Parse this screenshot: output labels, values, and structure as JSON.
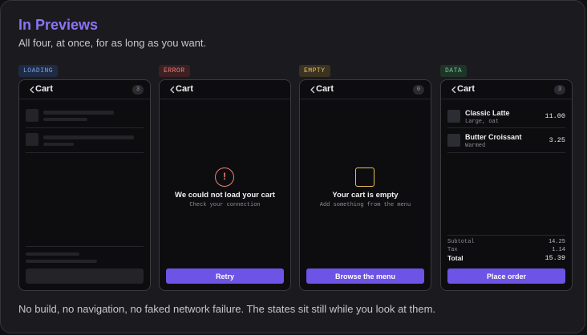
{
  "header": {
    "title": "In Previews",
    "subtitle": "All four, at once, for as long as you want."
  },
  "caption": "No build, no navigation, no faked network failure. The states sit still while you look at them.",
  "colors": {
    "accent": "#8c73f4",
    "button": "#6d53e6",
    "error": "#ec8076",
    "empty": "#e6c05c"
  },
  "previews": {
    "loading": {
      "badge": "LOADING",
      "title": "Cart",
      "count": "3",
      "icon": "chevron-left-icon"
    },
    "error": {
      "badge": "ERROR",
      "title": "Cart",
      "icon_glyph": "!",
      "message": "We could not load your cart",
      "detail": "Check your connection",
      "button": "Retry"
    },
    "empty": {
      "badge": "EMPTY",
      "title": "Cart",
      "count": "0",
      "message": "Your cart is empty",
      "detail": "Add something from the menu",
      "button": "Browse the menu"
    },
    "data": {
      "badge": "DATA",
      "title": "Cart",
      "count": "3",
      "items": [
        {
          "name": "Classic Latte",
          "note": "Large, oat",
          "price": "11.00"
        },
        {
          "name": "Butter Croissant",
          "note": "Warmed",
          "price": "3.25"
        }
      ],
      "summary": {
        "subtotal_label": "Subtotal",
        "subtotal": "14.25",
        "tax_label": "Tax",
        "tax": "1.14",
        "total_label": "Total",
        "total": "15.39"
      },
      "button": "Place order"
    }
  }
}
